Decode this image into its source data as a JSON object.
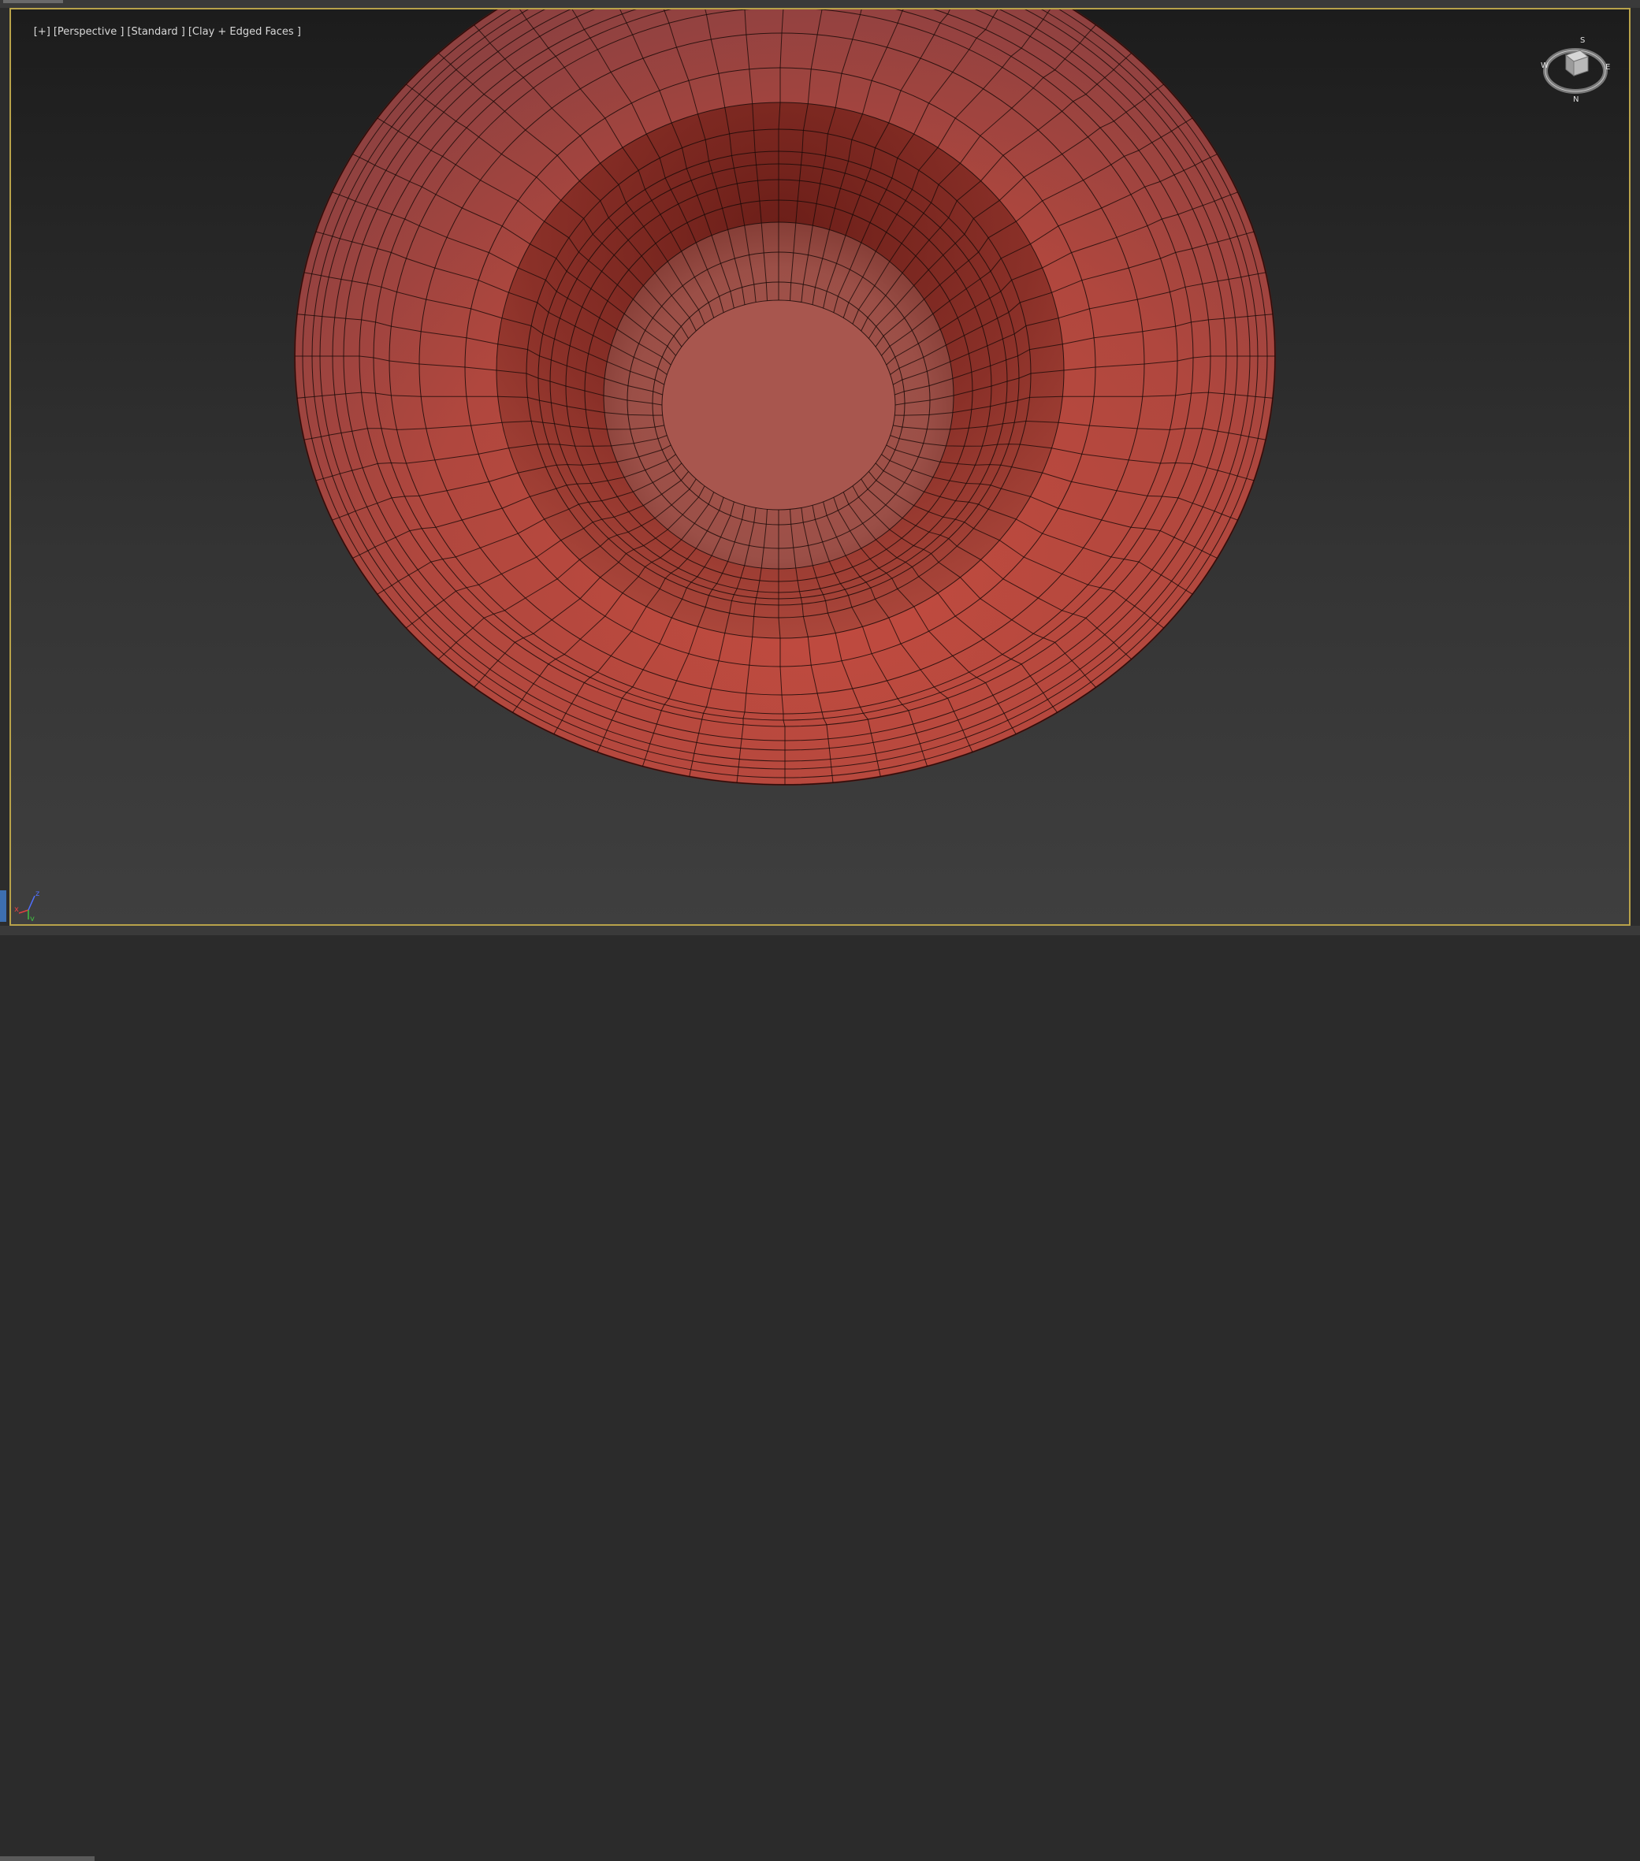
{
  "viewport": {
    "labels": [
      "[+]",
      "[Perspective ]",
      "[Standard ]",
      "[Clay + Edged Faces ]"
    ]
  },
  "viewcube": {
    "compass": [
      "N",
      "S",
      "E",
      "W"
    ]
  },
  "axis_tripod": {
    "x": "x",
    "y": "y",
    "z": "z"
  },
  "colors": {
    "viewport_border": "#b8a24a",
    "clay": "#b5483e",
    "wire": "#1a0a08"
  }
}
